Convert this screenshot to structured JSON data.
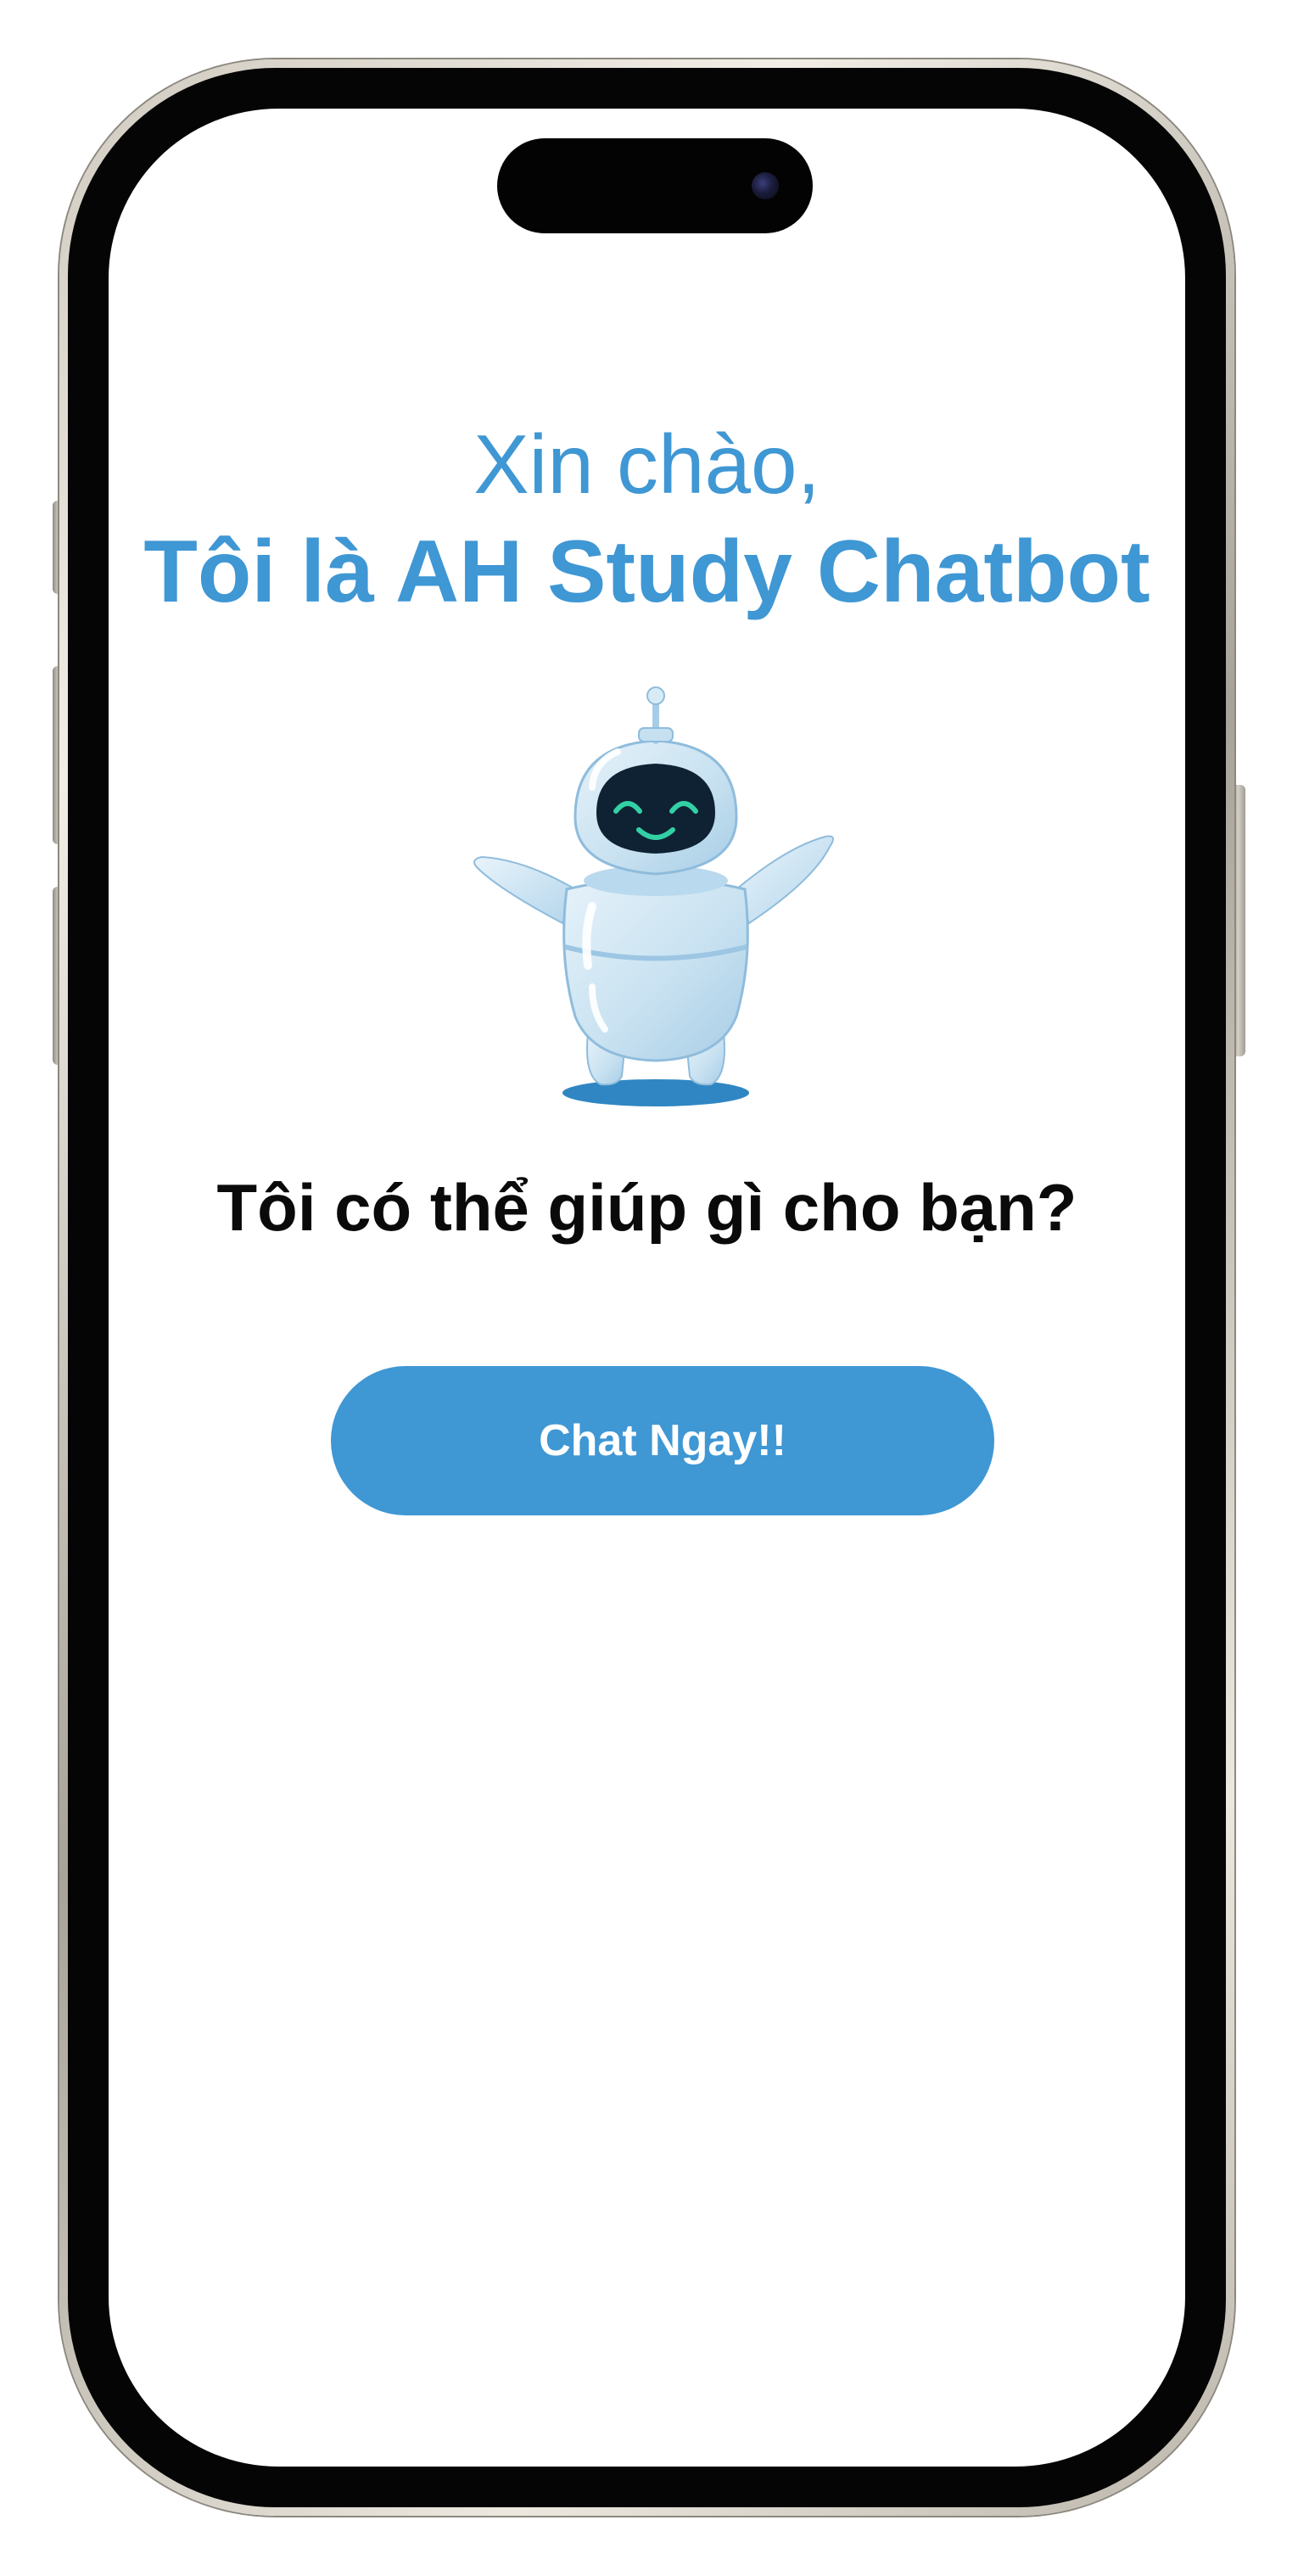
{
  "welcome": {
    "greeting": "Xin chào,",
    "bot_intro": "Tôi là AH Study Chatbot",
    "question": "Tôi có thể giúp gì cho bạn?",
    "chat_button_label": "Chat Ngay!!"
  },
  "illustration": {
    "name": "robot-mascot-icon"
  },
  "colors": {
    "accent": "#3f97d4",
    "text": "#0a0a0a",
    "screen_background": "#ffffff",
    "button_text": "#ffffff"
  }
}
